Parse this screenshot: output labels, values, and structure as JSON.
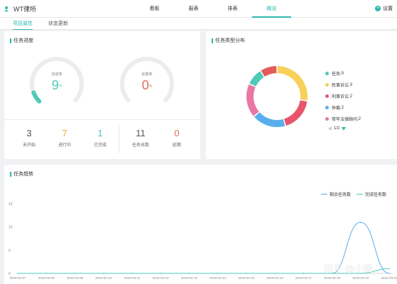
{
  "app": {
    "name": "WT律所"
  },
  "nav": {
    "items": [
      {
        "label": "看板"
      },
      {
        "label": "报表"
      },
      {
        "label": "排表"
      },
      {
        "label": "概览"
      }
    ],
    "active_index": 3,
    "settings_label": "设置"
  },
  "subtabs": [
    {
      "label": "项目属性"
    },
    {
      "label": "状态更新"
    }
  ],
  "progress_panel": {
    "title": "任务进度",
    "completion": {
      "label": "完成率",
      "value": "9",
      "unit": "%",
      "fraction": 0.09
    },
    "overdue": {
      "label": "延期率",
      "value": "0",
      "unit": "%",
      "fraction": 0
    },
    "stats": [
      {
        "value": "3",
        "label": "未开始",
        "color": "#555555"
      },
      {
        "value": "7",
        "label": "进行中",
        "color": "#f0a53a"
      },
      {
        "value": "1",
        "label": "已完成",
        "color": "#4bc4c4"
      },
      {
        "value": "11",
        "label": "任务总数",
        "color": "#555555"
      },
      {
        "value": "0",
        "label": "延期",
        "color": "#e36b5c"
      }
    ]
  },
  "type_panel": {
    "title": "任务类型分布",
    "legend": [
      {
        "label": "任务: ",
        "value": "0",
        "color": "#4ecbb7"
      },
      {
        "label": "民事诉讼: ",
        "value": "3",
        "color": "#f7d15a"
      },
      {
        "label": "刑事诉讼: ",
        "value": "2",
        "color": "#e8546a"
      },
      {
        "label": "仲裁: ",
        "value": "2",
        "color": "#5aaeee"
      },
      {
        "label": "常年法律顾问: ",
        "value": "2",
        "color": "#e977a4"
      }
    ],
    "pager": "1/2"
  },
  "chart_data": {
    "type": "line",
    "title": "任务趋势",
    "x": [
      "2019-03-07",
      "2019-03-08",
      "2019-03-09",
      "2019-03-10",
      "2019-03-11",
      "2019-03-12",
      "2019-03-13",
      "2019-03-14",
      "2019-03-15",
      "2019-03-16",
      "2019-03-17",
      "2019-03-18",
      "2019-03-19",
      "2019-03-20"
    ],
    "series": [
      {
        "name": "剩余任务数",
        "color": "#5aaeee",
        "values": [
          0,
          0,
          0,
          0,
          0,
          0,
          0,
          0,
          0,
          0,
          0,
          0,
          11,
          0
        ]
      },
      {
        "name": "完成任务数",
        "color": "#4ecbb7",
        "values": [
          0,
          0,
          0,
          0,
          0,
          0,
          0,
          0,
          0,
          0,
          0,
          0,
          0,
          1
        ]
      }
    ],
    "yticks": [
      "0",
      "5",
      "10",
      "15"
    ],
    "ylim": [
      0,
      15
    ],
    "grid": false,
    "legend": "top-right"
  },
  "watermark": "知乎 @小娴"
}
